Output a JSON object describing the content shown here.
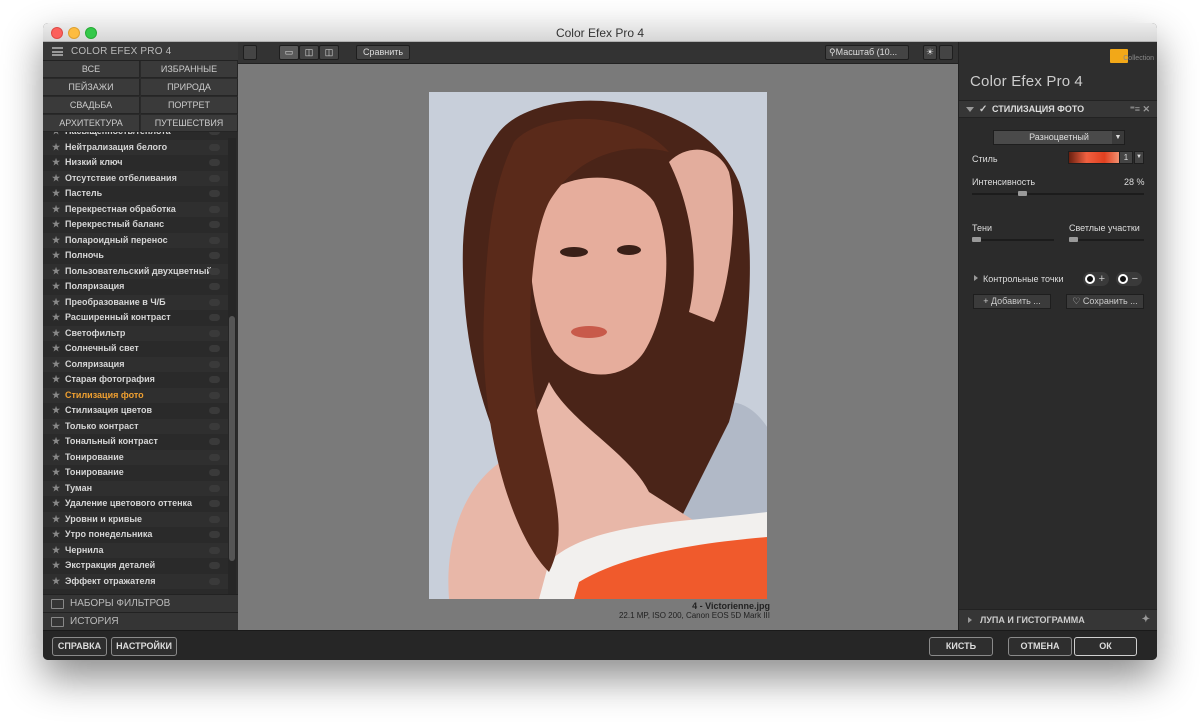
{
  "window": {
    "title": "Color Efex Pro 4"
  },
  "left_panel": {
    "header": "COLOR EFEX PRO 4",
    "categories": [
      "ВСЕ",
      "ИЗБРАННЫЕ",
      "ПЕЙЗАЖИ",
      "ПРИРОДА",
      "СВАДЬБА",
      "ПОРТРЕТ",
      "АРХИТЕКТУРА",
      "ПУТЕШЕСТВИЯ"
    ],
    "filters": [
      "Насыщенность/теплота",
      "Нейтрализация белого",
      "Низкий ключ",
      "Отсутствие отбеливания",
      "Пастель",
      "Перекрестная обработка",
      "Перекрестный баланс",
      "Полароидный перенос",
      "Полночь",
      "Пользовательский двухцветный",
      "Поляризация",
      "Преобразование в Ч/Б",
      "Расширенный контраст",
      "Светофильтр",
      "Солнечный свет",
      "Соляризация",
      "Старая фотография",
      "Стилизация фото",
      "Стилизация цветов",
      "Только контраст",
      "Тональный контраст",
      "Тонирование",
      "Тонирование",
      "Туман",
      "Удаление цветового оттенка",
      "Уровни и кривые",
      "Утро понедельника",
      "Чернила",
      "Экстракция деталей",
      "Эффект отражателя"
    ],
    "active_filter_index": 17,
    "filter_sets_label": "НАБОРЫ ФИЛЬТРОВ",
    "history_label": "ИСТОРИЯ"
  },
  "toolbar": {
    "compare_label": "Сравнить",
    "zoom_label": "Масштаб (10..."
  },
  "image": {
    "filename": "4 - Victorienne.jpg",
    "info": "22.1 MP, ISO 200, Canon EOS 5D Mark III"
  },
  "right_panel": {
    "app_title": "Color Efex Pro",
    "app_version": "4",
    "collection_label": "Collection",
    "filter_title": "СТИЛИЗАЦИЯ ФОТО",
    "preset_value": "Разноцветный",
    "style_label": "Стиль",
    "style_number": "1",
    "intensity_label": "Интенсивность",
    "intensity_value": "28 %",
    "intensity_fraction": 0.28,
    "shadows_label": "Тени",
    "highlights_label": "Светлые участки",
    "control_points_label": "Контрольные точки",
    "add_label": "Добавить ...",
    "save_label": "Сохранить ...",
    "loupe_label": "ЛУПА И ГИСТОГРАММА"
  },
  "bottom_bar": {
    "help": "СПРАВКА",
    "settings": "НАСТРОЙКИ",
    "brush": "КИСТЬ",
    "cancel": "ОТМЕНА",
    "ok": "ОК"
  }
}
